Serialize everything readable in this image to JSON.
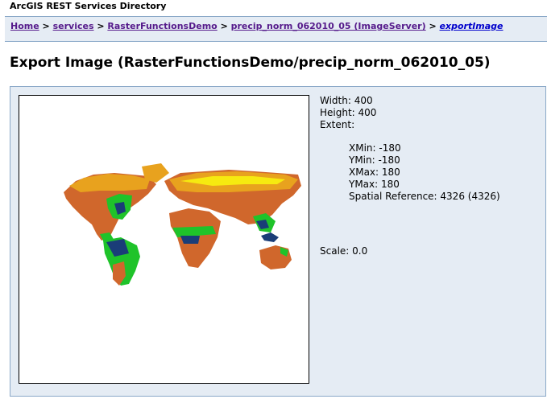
{
  "header": {
    "title": "ArcGIS REST Services Directory"
  },
  "breadcrumb": [
    {
      "label": "Home"
    },
    {
      "label": "services"
    },
    {
      "label": "RasterFunctionsDemo"
    },
    {
      "label": "precip_norm_062010_05 (ImageServer)"
    },
    {
      "label": "exportImage"
    }
  ],
  "breadcrumb_separator": ">",
  "page_title": "Export Image (RasterFunctionsDemo/precip_norm_062010_05)",
  "image_info": {
    "width": "Width: 400",
    "height": "Height: 400",
    "extent_label": "Extent:",
    "xmin": "XMin: -180",
    "ymin": "YMin: -180",
    "xmax": "XMax: 180",
    "ymax": "YMax: 180",
    "spatial_reference": "Spatial Reference: 4326  (4326)",
    "scale": "Scale: 0.0"
  },
  "map_colors": {
    "dry": "#d0672c",
    "semi_dry": "#e8a21e",
    "moderate": "#f6ea10",
    "wet": "#1fc32a",
    "very_wet": "#1a3d78"
  }
}
